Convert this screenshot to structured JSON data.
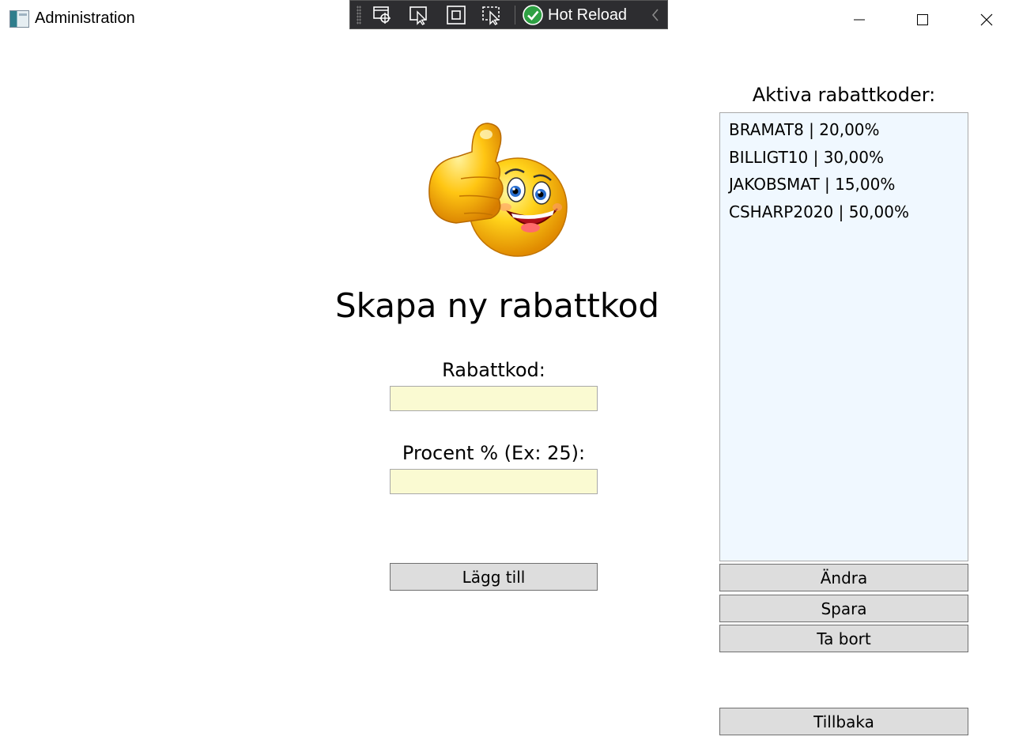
{
  "window": {
    "title": "Administration"
  },
  "debug_toolbar": {
    "hot_reload_label": "Hot Reload",
    "icons": [
      "select-element-icon",
      "inspect-pointer-icon",
      "layout-adorner-icon",
      "track-focus-icon",
      "hot-reload-check-icon",
      "collapse-chevron-icon"
    ]
  },
  "main": {
    "heading": "Skapa ny rabattkod",
    "code_label": "Rabattkod:",
    "code_value": "",
    "percent_label": "Procent % (Ex: 25):",
    "percent_value": "",
    "add_button": "Lägg till"
  },
  "sidebar": {
    "title": "Aktiva rabattkoder:",
    "items": [
      {
        "label": "BRAMAT8 | 20,00%"
      },
      {
        "label": "BILLIGT10 | 30,00%"
      },
      {
        "label": "JAKOBSMAT | 15,00%"
      },
      {
        "label": "CSHARP2020 | 50,00%"
      }
    ],
    "edit_button": "Ändra",
    "save_button": "Spara",
    "delete_button": "Ta bort",
    "back_button": "Tillbaka"
  },
  "colors": {
    "input_background": "#fafad2",
    "list_background": "#f0f8ff",
    "button_background": "#dddddd",
    "toolbar_background": "#2d2d30",
    "hot_reload_green": "#2ea043"
  }
}
